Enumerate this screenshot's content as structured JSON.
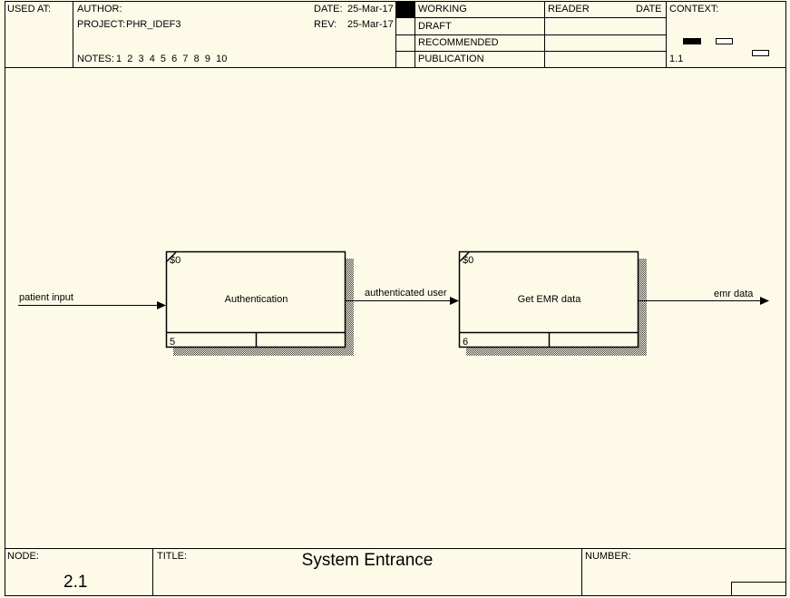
{
  "header": {
    "used_at_label": "USED AT:",
    "author_label": "AUTHOR:",
    "project_label": "PROJECT:",
    "project_value": "PHR_IDEF3",
    "notes_label": "NOTES:",
    "notes_numbers": "1  2  3  4  5  6  7  8  9  10",
    "date_label": "DATE:",
    "date_value": "25-Mar-17",
    "rev_label": "REV:",
    "rev_value": "25-Mar-17",
    "status": [
      "WORKING",
      "DRAFT",
      "RECOMMENDED",
      "PUBLICATION"
    ],
    "reader_label": "READER",
    "reader_date_label": "DATE",
    "context_label": "CONTEXT:",
    "context_node": "1.1"
  },
  "diagram": {
    "boxes": [
      {
        "ref": "$0",
        "label": "Authentication",
        "number": "5"
      },
      {
        "ref": "$0",
        "label": "Get EMR data",
        "number": "6"
      }
    ],
    "arrows": [
      {
        "label": "patient input"
      },
      {
        "label": "authenticated user"
      },
      {
        "label": "emr data"
      }
    ]
  },
  "footer": {
    "node_label": "NODE:",
    "node_value": "2.1",
    "title_label": "TITLE:",
    "title_value": "System Entrance",
    "number_label": "NUMBER:"
  },
  "colors": {
    "background": "#fdfbe8",
    "lines": "#000000",
    "working_marker": "#000000"
  }
}
